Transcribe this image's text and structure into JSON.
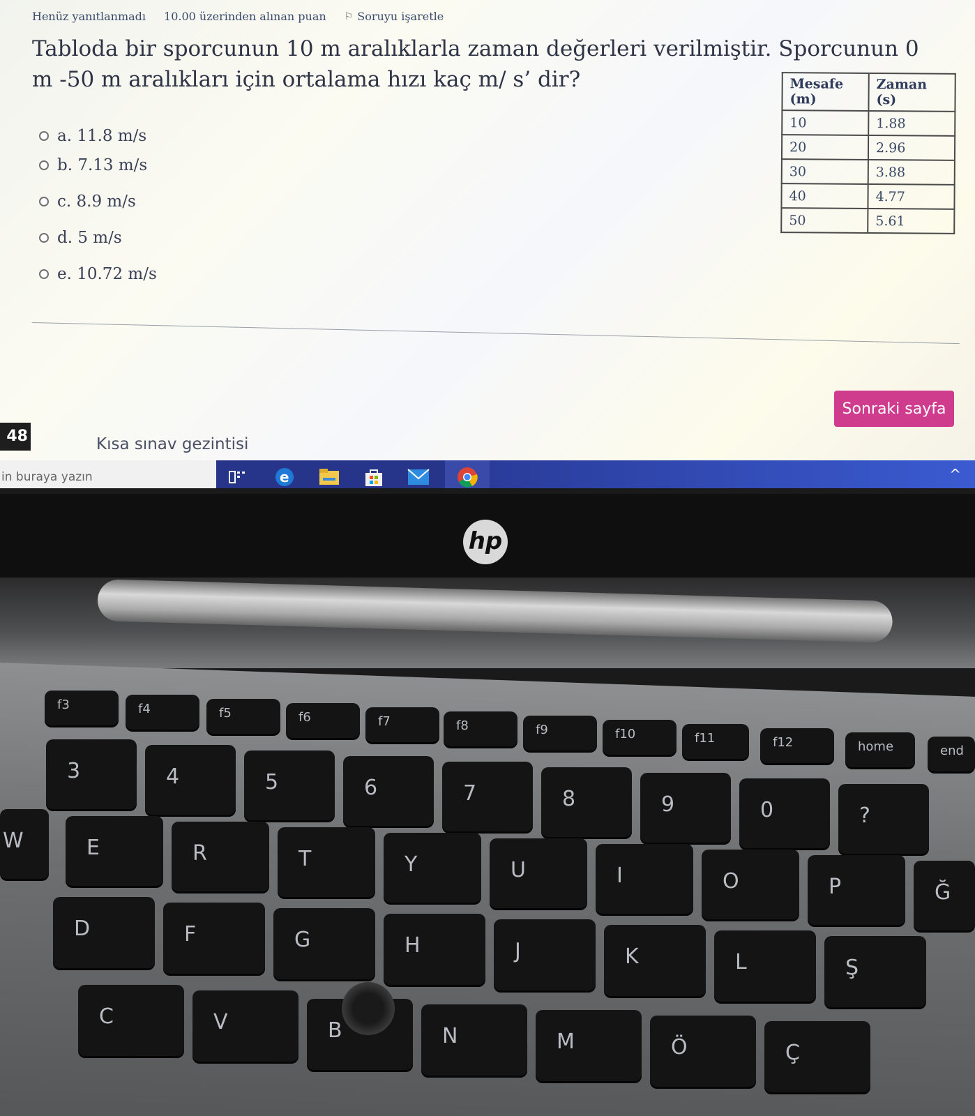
{
  "meta": {
    "status": "Henüz yanıtlanmadı",
    "points": "10.00 üzerinden alınan puan",
    "flag_label": "Soruyu işaretle",
    "flag_icon": "flag-icon"
  },
  "question": {
    "text": "Tabloda bir sporcunun 10 m aralıklarla zaman değerleri verilmiştir. Sporcunun 0 m -50 m aralıkları için ortalama hızı kaç m/ s’ dir?"
  },
  "options": [
    {
      "label": "a. 11.8 m/s"
    },
    {
      "label": "b. 7.13 m/s"
    },
    {
      "label": "c. 8.9 m/s"
    },
    {
      "label": "d. 5 m/s"
    },
    {
      "label": "e. 10.72 m/s"
    }
  ],
  "table": {
    "headers": [
      "Mesafe (m)",
      "Zaman (s)"
    ],
    "rows": [
      [
        "10",
        "1.88"
      ],
      [
        "20",
        "2.96"
      ],
      [
        "30",
        "3.88"
      ],
      [
        "40",
        "4.77"
      ],
      [
        "50",
        "5.61"
      ]
    ]
  },
  "next_button": "Sonraki sayfa",
  "timer": "48",
  "quiz_nav": "Kısa sınav gezintisi",
  "taskbar": {
    "search_placeholder": "in buraya yazın",
    "icons": [
      "task-view-icon",
      "edge-icon",
      "file-explorer-icon",
      "store-icon",
      "mail-icon",
      "chrome-icon"
    ],
    "accent": "#26348a"
  },
  "laptop": {
    "logo": "hp",
    "keys": {
      "f3": "f3",
      "f4": "f4",
      "f5": "f5",
      "f6": "f6",
      "f7": "f7",
      "f8": "f8",
      "f9": "f9",
      "f10": "f10",
      "f11": "f11",
      "f12": "f12",
      "home": "home",
      "end": "end",
      "k3": "3",
      "k4": "4",
      "k5": "5",
      "k6": "6",
      "k7": "7",
      "k8": "8",
      "k9": "9",
      "k0": "0",
      "kq": "?",
      "w": "W",
      "e": "E",
      "r": "R",
      "t": "T",
      "y": "Y",
      "u": "U",
      "i": "I",
      "o": "O",
      "p": "P",
      "gbreve": "Ğ",
      "d": "D",
      "f": "F",
      "g": "G",
      "h": "H",
      "j": "J",
      "k": "K",
      "l": "L",
      "scedil": "Ş",
      "c": "C",
      "v": "V",
      "b": "B",
      "n": "N",
      "m": "M",
      "ouml": "Ö",
      "ccedil": "Ç"
    }
  }
}
